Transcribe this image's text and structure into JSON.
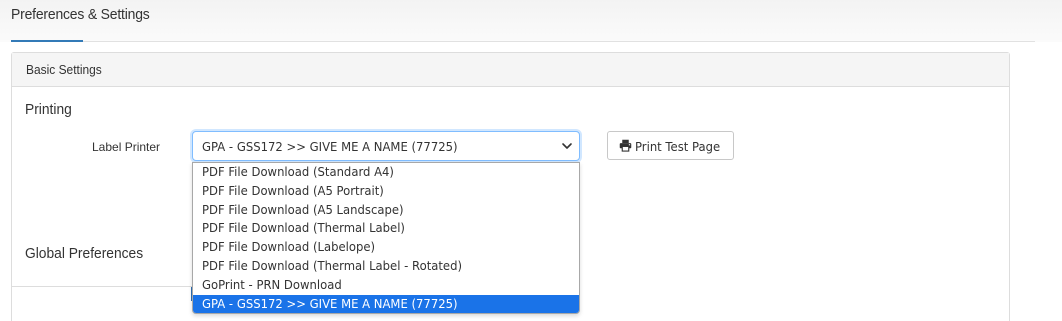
{
  "page": {
    "title": "Preferences & Settings"
  },
  "panel": {
    "heading": "Basic Settings"
  },
  "printing": {
    "section_title": "Printing",
    "label_printer_label": "Label Printer",
    "selected_value": "GPA - GSS172 >> GIVE ME A NAME (77725)",
    "print_test_button": "Print Test Page",
    "options": [
      "PDF File Download (Standard A4)",
      "PDF File Download (A5 Portrait)",
      "PDF File Download (A5 Landscape)",
      "PDF File Download (Thermal Label)",
      "PDF File Download (Labelope)",
      "PDF File Download (Thermal Label - Rotated)",
      "GoPrint - PRN Download",
      "GPA - GSS172 >> GIVE ME A NAME (77725)"
    ],
    "selected_index": 7
  },
  "global_preferences": {
    "section_title": "Global Preferences"
  },
  "colors": {
    "accent": "#337ab7",
    "focus_border": "#80bdff",
    "selected_option_bg": "#1a73e8"
  },
  "icons": {
    "dropdown": "chevron-down-icon",
    "print": "printer-icon"
  }
}
